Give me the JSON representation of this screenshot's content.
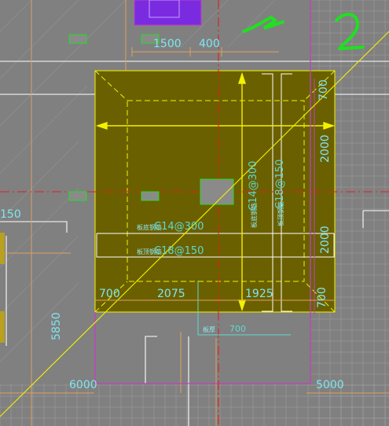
{
  "drawing": {
    "colors": {
      "background": "#808080",
      "grid": "#9a9a9a",
      "foundation_fill": "#6b6000",
      "foundation_outline": "#f2f200",
      "axis_red": "#e02020",
      "wall_magenta": "#c040c0",
      "dimension_cyan": "#7fe5f0",
      "annotation_green": "#20e020",
      "column_purple": "#7a2be0"
    },
    "dimensions": {
      "d1500": "1500",
      "d400": "400",
      "d700_top": "700",
      "d2000_upper": "2000",
      "d2000_lower": "2000",
      "d700_right": "700",
      "d700_bottom_left": "700",
      "d2075": "2075",
      "d1925": "1925",
      "d150_left": "150",
      "d5850": "5850",
      "d6000": "6000",
      "d5000": "5000"
    },
    "rebar": {
      "bottom_x_label": "C14@300",
      "top_x_label": "C18@150",
      "bottom_y_label": "C14@300",
      "top_y_label": "C18@150",
      "bottom_prefix": "板底钢筋",
      "top_prefix": "板顶钢筋"
    },
    "notes": {
      "slab_thickness": "700",
      "slab_prefix": "板厚"
    },
    "handwriting": {
      "mark_dash": "—",
      "mark_two": "2"
    }
  }
}
